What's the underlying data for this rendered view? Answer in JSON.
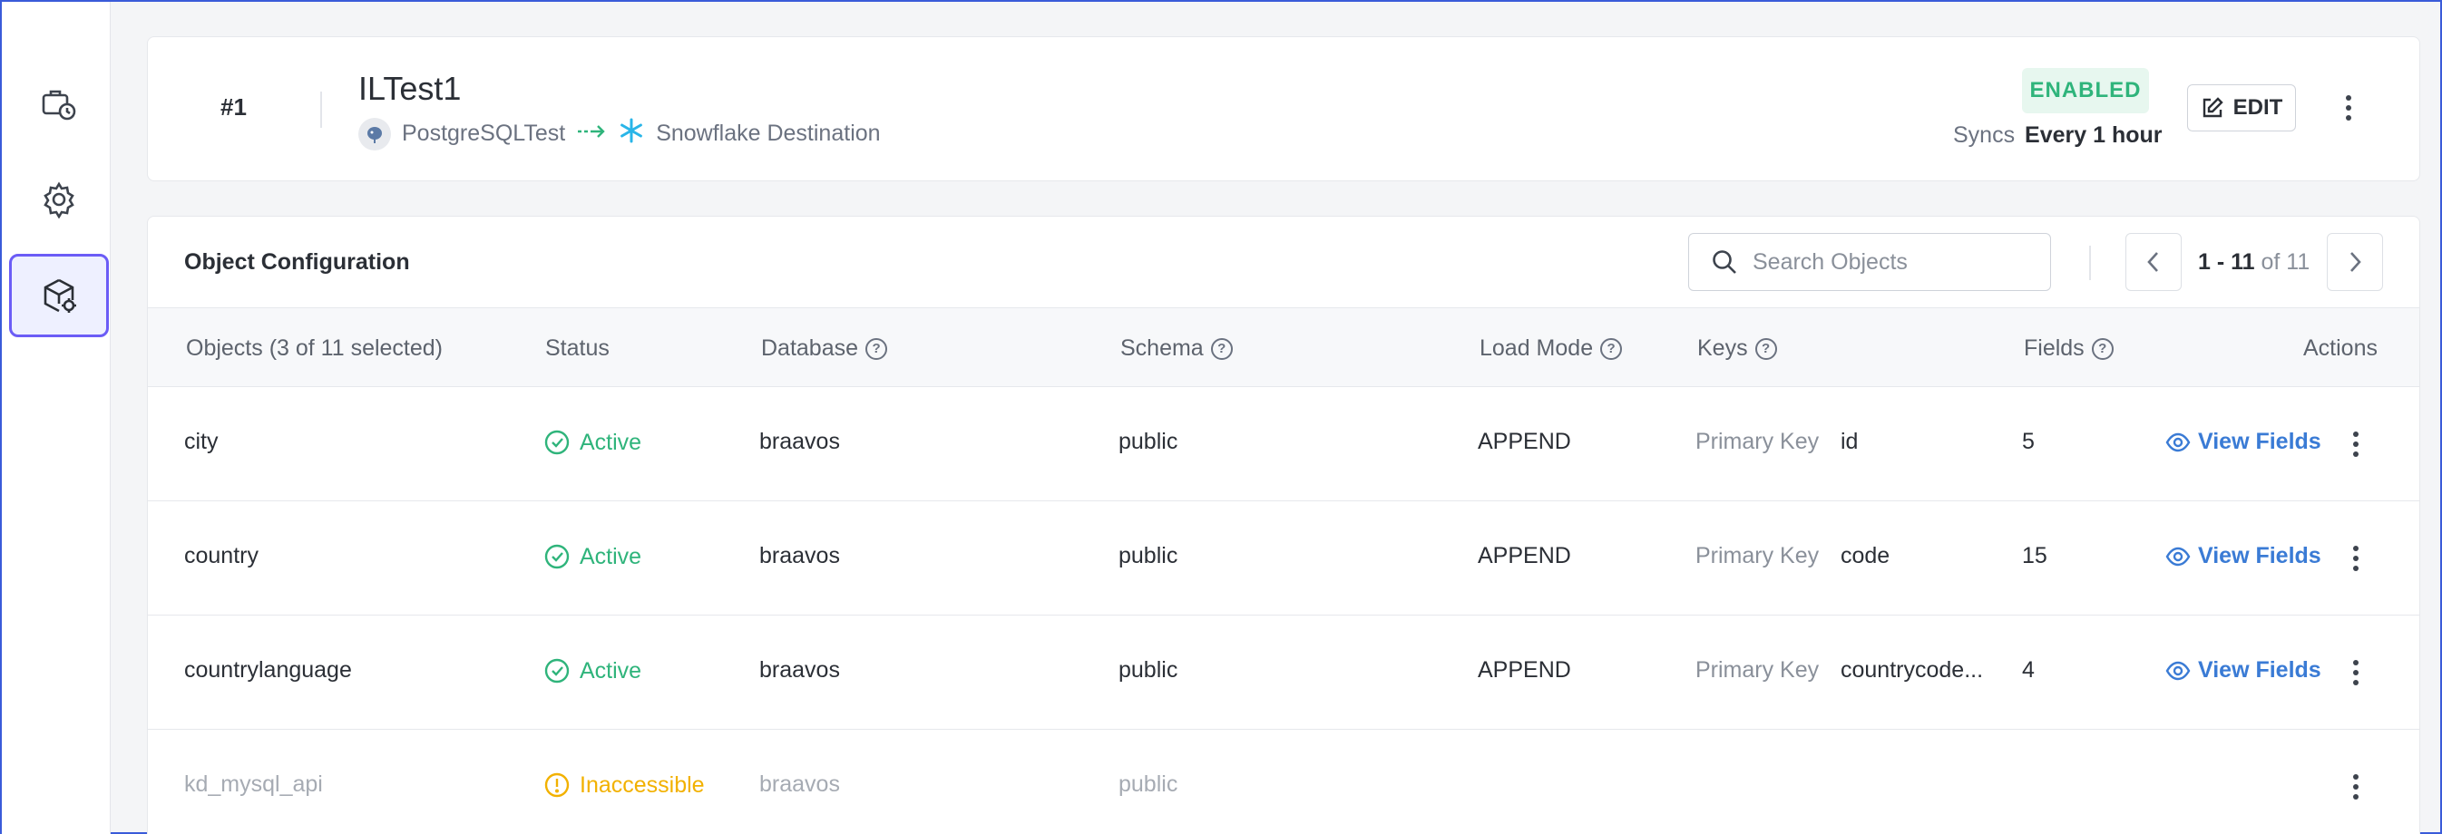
{
  "sidebar": {
    "items": [
      {
        "name": "pipelines",
        "icon": "briefcase-clock-icon"
      },
      {
        "name": "settings",
        "icon": "gear-icon"
      },
      {
        "name": "objects",
        "icon": "cube-gear-icon",
        "active": true
      }
    ]
  },
  "header": {
    "number": "#1",
    "title": "ILTest1",
    "source": "PostgreSQLTest",
    "destination": "Snowflake Destination",
    "status_badge": "ENABLED",
    "syncs_label": "Syncs",
    "syncs_value": "Every 1 hour",
    "edit_label": "EDIT"
  },
  "objects_panel": {
    "title": "Object Configuration",
    "search_placeholder": "Search Objects",
    "pagination": {
      "range": "1 - 11",
      "of_label": "of 11"
    },
    "columns": {
      "objects": "Objects (3 of 11 selected)",
      "status": "Status",
      "database": "Database",
      "schema": "Schema",
      "load_mode": "Load Mode",
      "keys": "Keys",
      "fields": "Fields",
      "actions": "Actions"
    },
    "rows": [
      {
        "object": "city",
        "status": "Active",
        "database": "braavos",
        "schema": "public",
        "load_mode": "APPEND",
        "key_type": "Primary Key",
        "key_value": "id",
        "fields": "5",
        "action": "View Fields"
      },
      {
        "object": "country",
        "status": "Active",
        "database": "braavos",
        "schema": "public",
        "load_mode": "APPEND",
        "key_type": "Primary Key",
        "key_value": "code",
        "fields": "15",
        "action": "View Fields"
      },
      {
        "object": "countrylanguage",
        "status": "Active",
        "database": "braavos",
        "schema": "public",
        "load_mode": "APPEND",
        "key_type": "Primary Key",
        "key_value": "countrycode...",
        "fields": "4",
        "action": "View Fields"
      },
      {
        "object": "kd_mysql_api",
        "status": "Inaccessible",
        "database": "braavos",
        "schema": "public"
      }
    ]
  },
  "colors": {
    "active": "#2fb47b",
    "inaccessible": "#f2b100",
    "link": "#3a7bd5",
    "sidebar_active_border": "#6b5cf6"
  }
}
